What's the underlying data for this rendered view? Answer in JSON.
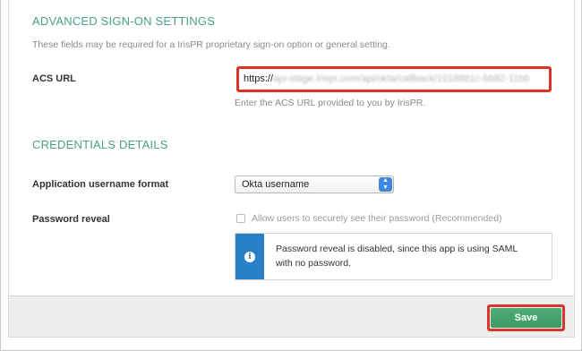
{
  "advanced": {
    "title": "ADVANCED SIGN-ON SETTINGS",
    "description": "These fields may be required for a IrisPR proprietary sign-on option or general setting.",
    "acs_label": "ACS URL",
    "acs_value_visible": "https://",
    "acs_value_blurred": "api-stage.irispr.com/api/okta/callback/1018881c-bb82-11bb",
    "acs_hint": "Enter the ACS URL provided to you by IrisPR."
  },
  "credentials": {
    "title": "CREDENTIALS DETAILS",
    "username_format_label": "Application username format",
    "username_format_value": "Okta username",
    "password_reveal_label": "Password reveal",
    "password_reveal_checkbox_label": "Allow users to securely see their password (Recommended)",
    "password_reveal_checked": false,
    "info_text_line1": "Password reveal is disabled, since this app is using SAML",
    "info_text_line2": "with no password."
  },
  "footer": {
    "save_label": "Save"
  },
  "colors": {
    "section_title": "#49a37b",
    "highlight": "#d9362a",
    "info_bar": "#2a80c8",
    "save_button": "#3c9a64",
    "select_arrow": "#3f86df"
  },
  "icons": {
    "info": "info-icon",
    "select_arrow": "updown-chevron-icon"
  }
}
